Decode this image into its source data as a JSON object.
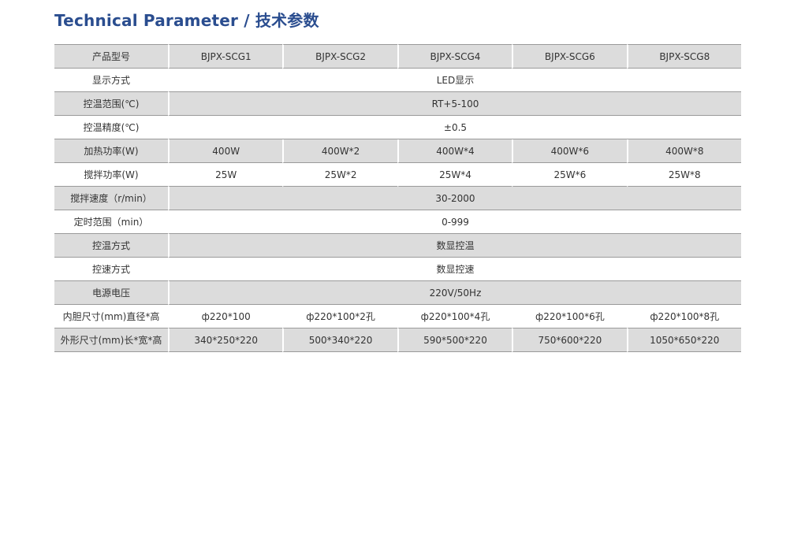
{
  "title": "Technical Parameter / 技术参数",
  "table": {
    "rows": [
      {
        "label": "产品型号",
        "cells": [
          "BJPX-SCG1",
          "BJPX-SCG2",
          "BJPX-SCG4",
          "BJPX-SCG6",
          "BJPX-SCG8"
        ]
      },
      {
        "label": "显示方式",
        "merged": "LED显示"
      },
      {
        "label": "控温范围(℃)",
        "merged": "RT+5-100"
      },
      {
        "label": "控温精度(℃)",
        "merged": "±0.5"
      },
      {
        "label": "加热功率(W)",
        "cells": [
          "400W",
          "400W*2",
          "400W*4",
          "400W*6",
          "400W*8"
        ]
      },
      {
        "label": "搅拌功率(W)",
        "cells": [
          "25W",
          "25W*2",
          "25W*4",
          "25W*6",
          "25W*8"
        ]
      },
      {
        "label": "搅拌速度（r/min）",
        "merged": "30-2000"
      },
      {
        "label": "定时范围（min）",
        "merged": "0-999"
      },
      {
        "label": "控温方式",
        "merged": "数显控温"
      },
      {
        "label": "控速方式",
        "merged": "数显控速"
      },
      {
        "label": "电源电压",
        "merged": "220V/50Hz"
      },
      {
        "label": "内胆尺寸(mm)直径*高",
        "cells": [
          "ф220*100",
          "ф220*100*2孔",
          "ф220*100*4孔",
          "ф220*100*6孔",
          "ф220*100*8孔"
        ]
      },
      {
        "label": "外形尺寸(mm)长*宽*高",
        "cells": [
          "340*250*220",
          "500*340*220",
          "590*500*220",
          "750*600*220",
          "1050*650*220"
        ]
      }
    ]
  }
}
